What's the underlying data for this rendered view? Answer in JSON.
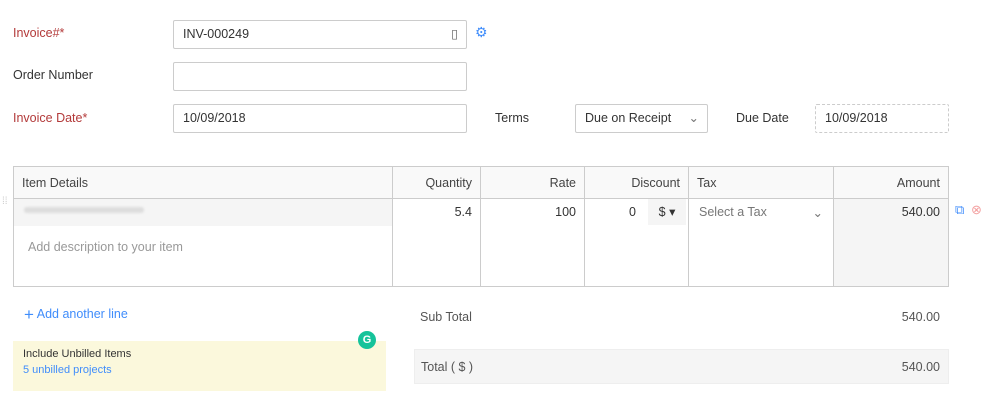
{
  "form": {
    "invoice_label": "Invoice#*",
    "invoice_value": "INV-000249",
    "order_label": "Order Number",
    "order_value": "",
    "date_label": "Invoice Date*",
    "date_value": "10/09/2018",
    "terms_label": "Terms",
    "terms_value": "Due on Receipt",
    "due_label": "Due Date",
    "due_value": "10/09/2018"
  },
  "table": {
    "headers": [
      "Item Details",
      "Quantity",
      "Rate",
      "Discount",
      "Tax",
      "Amount"
    ],
    "row": {
      "description_placeholder": "Add description to your item",
      "quantity": "5.4",
      "rate": "100",
      "discount": "0",
      "discount_unit": "$",
      "tax": "Select a Tax",
      "amount": "540.00"
    }
  },
  "add_line": "Add another line",
  "unbilled": {
    "title": "Include Unbilled Items",
    "link": "5 unbilled projects"
  },
  "totals": {
    "sub_label": "Sub Total",
    "sub_value": "540.00",
    "total_label": "Total ( $ )",
    "total_value": "540.00"
  }
}
